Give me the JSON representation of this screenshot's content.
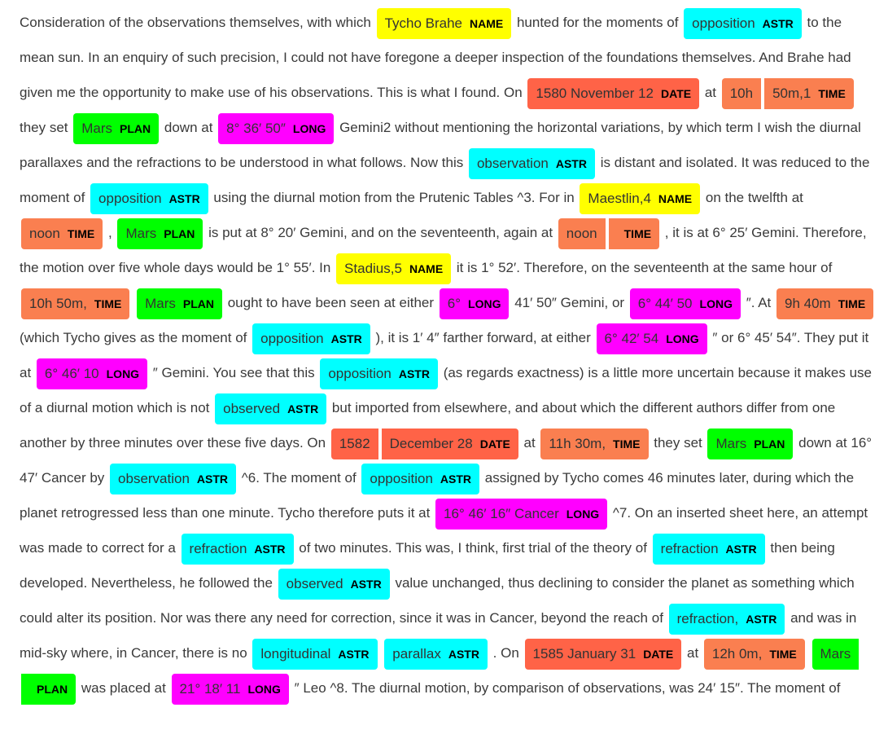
{
  "colors": {
    "NAME": "#ffff00",
    "ASTR": "#00ffff",
    "DATE": "#ff6347",
    "TIME": "#fa7f50",
    "PLAN": "#00ff00",
    "LONG": "#ff00ff"
  },
  "segments": [
    {
      "t": "Consideration of the observations themselves, with which "
    },
    {
      "e": "Tycho Brahe",
      "l": "NAME"
    },
    {
      "t": " hunted for the moments of "
    },
    {
      "e": "opposition",
      "l": "ASTR"
    },
    {
      "t": " to the mean sun. In an enquiry of such precision, I could not have foregone a deeper inspection of the foundations themselves. And Brahe had given me the opportunity to make use of his observations. This is what I found. On "
    },
    {
      "e": "1580 November 12",
      "l": "DATE"
    },
    {
      "t": " at "
    },
    {
      "e": "10h",
      "l": "",
      "split": "start"
    },
    {
      "e": "50m,1",
      "l": "TIME",
      "split": "end"
    },
    {
      "t": " they set "
    },
    {
      "e": "Mars",
      "l": "PLAN"
    },
    {
      "t": " down at "
    },
    {
      "e": "8° 36′ 50″",
      "l": "LONG"
    },
    {
      "t": " Gemini2 without mentioning the horizontal variations, by which term I wish the diurnal parallaxes and the refractions to be understood in what follows. Now this "
    },
    {
      "e": "observation",
      "l": "ASTR"
    },
    {
      "t": " is distant and isolated. It was reduced to the moment of "
    },
    {
      "e": "opposition",
      "l": "ASTR"
    },
    {
      "t": " using the diurnal motion from the Prutenic Tables ^3. For in "
    },
    {
      "e": "Maestlin,4",
      "l": "NAME"
    },
    {
      "t": " on the twelfth at "
    },
    {
      "e": "noon",
      "l": "TIME"
    },
    {
      "t": " , "
    },
    {
      "e": "Mars",
      "l": "PLAN"
    },
    {
      "t": " is put at 8° 20′ Gemini, and on the seventeenth, again at "
    },
    {
      "e": "noon",
      "l": "",
      "split": "start"
    },
    {
      "e": "",
      "l": "TIME",
      "split": "end"
    },
    {
      "t": " , it is at 6° 25′ Gemini. Therefore, the motion over five whole days would be 1° 55′. In "
    },
    {
      "e": "Stadius,5",
      "l": "NAME"
    },
    {
      "t": " it is 1° 52′. Therefore, on the seventeenth at the same hour of "
    },
    {
      "e": "10h 50m,",
      "l": "TIME"
    },
    {
      "t": " "
    },
    {
      "e": "Mars",
      "l": "PLAN"
    },
    {
      "t": " ought to have been seen at either "
    },
    {
      "e": "6°",
      "l": "LONG"
    },
    {
      "t": " 41′ 50″ Gemini, or "
    },
    {
      "e": "6° 44′ 50",
      "l": "LONG"
    },
    {
      "t": " ″. At "
    },
    {
      "e": "9h 40m",
      "l": "TIME"
    },
    {
      "t": " (which Tycho gives as the moment of "
    },
    {
      "e": "opposition",
      "l": "ASTR"
    },
    {
      "t": " ), it is 1′ 4″ farther forward, at either "
    },
    {
      "e": "6° 42′ 54",
      "l": "LONG"
    },
    {
      "t": " ″ or 6° 45′ 54″. They put it at "
    },
    {
      "e": "6° 46′ 10",
      "l": "LONG"
    },
    {
      "t": " ″ Gemini. You see that this "
    },
    {
      "e": "opposition",
      "l": "ASTR"
    },
    {
      "t": " (as regards exactness) is a little more uncertain because it makes use of a diurnal motion which is not "
    },
    {
      "e": "observed",
      "l": "ASTR"
    },
    {
      "t": " but imported from elsewhere, and about which the different authors differ from one another by three minutes over these five days. On "
    },
    {
      "e": "1582",
      "l": "",
      "split": "start"
    },
    {
      "e": "December 28",
      "l": "DATE",
      "split": "end"
    },
    {
      "t": " at "
    },
    {
      "e": "11h 30m,",
      "l": "TIME"
    },
    {
      "t": " they set "
    },
    {
      "e": "Mars",
      "l": "PLAN"
    },
    {
      "t": " down at 16° 47′ Cancer by "
    },
    {
      "e": "observation",
      "l": "ASTR"
    },
    {
      "t": " ^6. The moment of "
    },
    {
      "e": "opposition",
      "l": "ASTR"
    },
    {
      "t": " assigned by Tycho comes 46 minutes later, during which the planet retrogressed less than one minute. Tycho therefore puts it at "
    },
    {
      "e": "16° 46′ 16″ Cancer",
      "l": "LONG"
    },
    {
      "t": " ^7. On an inserted sheet here, an attempt was made to correct for a "
    },
    {
      "e": "refraction",
      "l": "ASTR"
    },
    {
      "t": " of two minutes. This was, I think, first trial of the theory of "
    },
    {
      "e": "refraction",
      "l": "ASTR"
    },
    {
      "t": " then being developed. Nevertheless, he followed the "
    },
    {
      "e": "observed",
      "l": "ASTR"
    },
    {
      "t": " value unchanged, thus declining to consider the planet as something which could alter its position. Nor was there any need for correction, since it was in Cancer, beyond the reach of "
    },
    {
      "e": "refraction,",
      "l": "ASTR"
    },
    {
      "t": " and was in mid-sky where, in Cancer, there is no "
    },
    {
      "e": "longitudinal",
      "l": "ASTR"
    },
    {
      "t": " "
    },
    {
      "e": "parallax",
      "l": "ASTR"
    },
    {
      "t": " . On "
    },
    {
      "e": "1585 January 31",
      "l": "DATE"
    },
    {
      "t": " at "
    },
    {
      "e": "12h 0m,",
      "l": "TIME"
    },
    {
      "t": " "
    },
    {
      "e": "Mars",
      "l": "",
      "split": "start"
    },
    {
      "e": "",
      "l": "PLAN",
      "split": "end"
    },
    {
      "t": " was placed at "
    },
    {
      "e": "21° 18′ 11",
      "l": "LONG"
    },
    {
      "t": " ″ Leo ^8. The diurnal motion, by comparison of observations, was 24′ 15″. The moment of"
    }
  ]
}
